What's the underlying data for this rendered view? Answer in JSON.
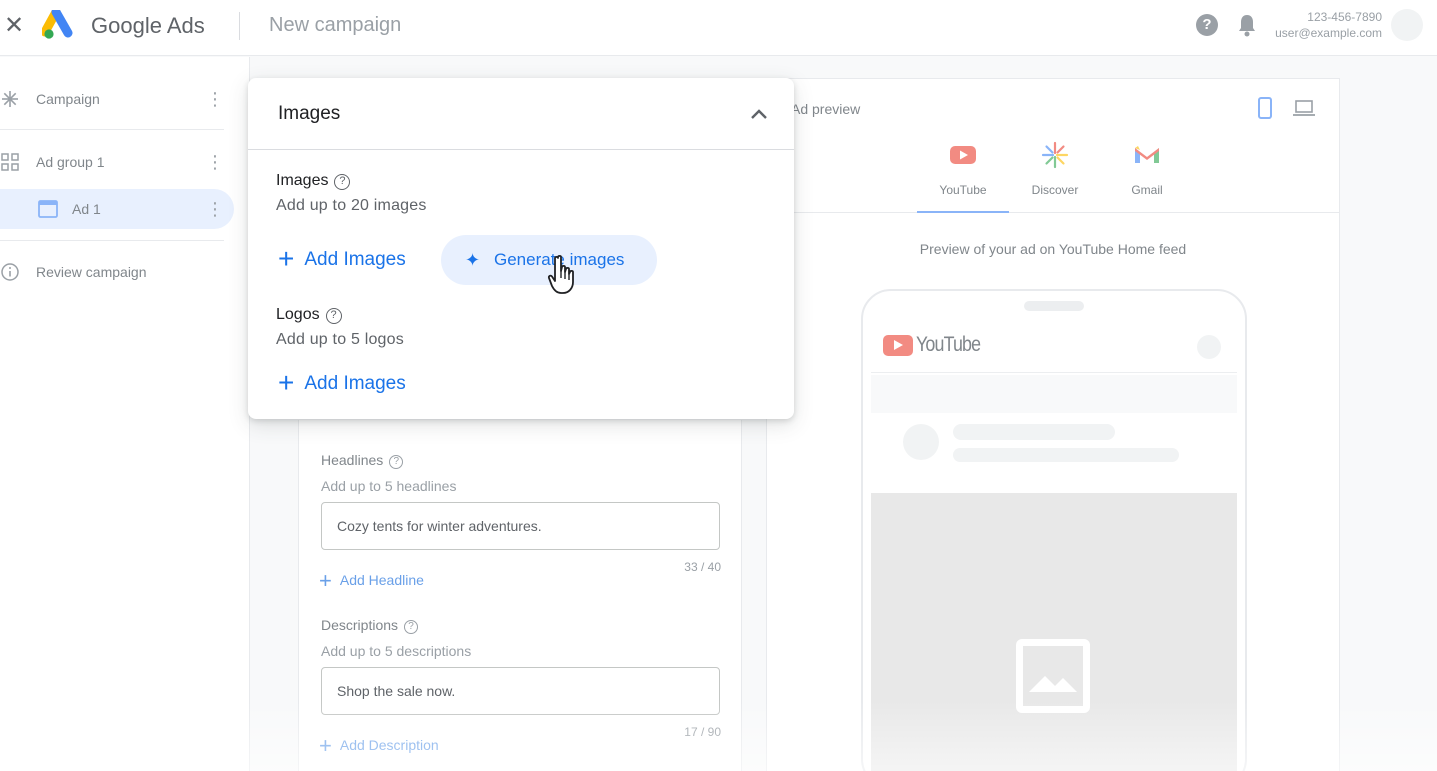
{
  "header": {
    "brand": "Google Ads",
    "page_title": "New campaign",
    "account_phone": "123-456-7890",
    "account_email": "user@example.com"
  },
  "sidebar": {
    "items": [
      {
        "label": "Campaign",
        "icon": "asterisk-icon"
      },
      {
        "label": "Ad group 1",
        "icon": "grid-icon"
      },
      {
        "label": "Ad 1",
        "icon": "ad-window-icon"
      },
      {
        "label": "Review campaign",
        "icon": "info-icon"
      }
    ]
  },
  "images_panel": {
    "title": "Images",
    "images_section": {
      "title": "Images",
      "subtitle": "Add up to 20 images",
      "add_label": "Add Images",
      "generate_label": "Generate images"
    },
    "logos_section": {
      "title": "Logos",
      "subtitle": "Add up to 5 logos",
      "add_label": "Add Images"
    }
  },
  "form": {
    "headlines": {
      "label": "Headlines",
      "subtitle": "Add up to 5 headlines",
      "value": "Cozy tents for winter adventures.",
      "count": "33 / 40",
      "add_label": "Add Headline"
    },
    "descriptions": {
      "label": "Descriptions",
      "subtitle": "Add up to 5 descriptions",
      "value": "Shop the sale now.",
      "count": "17 / 90",
      "add_label": "Add Description"
    }
  },
  "preview": {
    "title": "Ad preview",
    "tabs": [
      {
        "label": "YouTube",
        "icon": "youtube-icon",
        "active": true
      },
      {
        "label": "Discover",
        "icon": "discover-icon",
        "active": false
      },
      {
        "label": "Gmail",
        "icon": "gmail-icon",
        "active": false
      }
    ],
    "caption": "Preview of your ad on YouTube Home feed",
    "youtube_wordmark": "YouTube"
  },
  "colors": {
    "accent": "#1a73e8",
    "accent_light": "#e8f0fe",
    "youtube_red": "#f28b82"
  }
}
